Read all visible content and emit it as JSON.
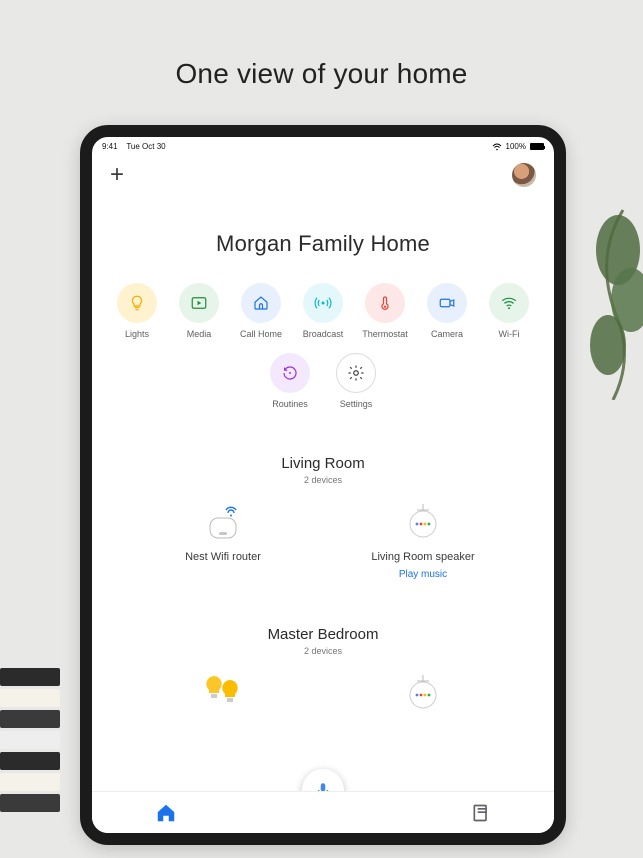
{
  "headline": "One view of your home",
  "statusbar": {
    "time": "9:41",
    "date": "Tue Oct 30",
    "battery": "100%"
  },
  "home_title": "Morgan Family Home",
  "actions": [
    {
      "label": "Lights",
      "icon": "bulb",
      "bg": "#fff3cf",
      "fg": "#f9ab00"
    },
    {
      "label": "Media",
      "icon": "media",
      "bg": "#e6f4ea",
      "fg": "#1e8e3e"
    },
    {
      "label": "Call Home",
      "icon": "callhome",
      "bg": "#e8f0fe",
      "fg": "#1a73e8"
    },
    {
      "label": "Broadcast",
      "icon": "broadcast",
      "bg": "#e4f7fb",
      "fg": "#12b5cb"
    },
    {
      "label": "Thermostat",
      "icon": "thermostat",
      "bg": "#fde8e7",
      "fg": "#ea4335"
    },
    {
      "label": "Camera",
      "icon": "camera",
      "bg": "#e8f0fe",
      "fg": "#1a73e8"
    },
    {
      "label": "Wi-Fi",
      "icon": "wifi",
      "bg": "#e6f4ea",
      "fg": "#1e8e3e"
    }
  ],
  "actions_row2": [
    {
      "label": "Routines",
      "icon": "routines",
      "bg": "#f3e8fd",
      "fg": "#9334e6"
    },
    {
      "label": "Settings",
      "icon": "gear",
      "bg": "#ffffff",
      "fg": "#3c4043"
    }
  ],
  "rooms": [
    {
      "name": "Living Room",
      "sub": "2 devices",
      "devices": [
        {
          "name": "Nest Wifi router",
          "icon": "router",
          "link": ""
        },
        {
          "name": "Living Room speaker",
          "icon": "speaker",
          "link": "Play music"
        }
      ]
    },
    {
      "name": "Master  Bedroom",
      "sub": "2 devices",
      "devices": [
        {
          "name": "",
          "icon": "bulbs",
          "link": ""
        },
        {
          "name": "",
          "icon": "speaker",
          "link": ""
        }
      ]
    }
  ]
}
